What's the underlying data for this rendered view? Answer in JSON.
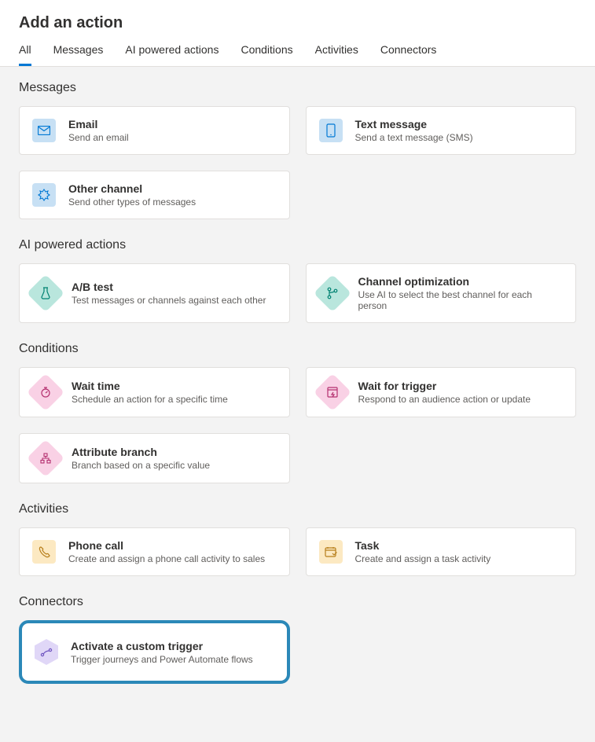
{
  "header": {
    "title": "Add an action"
  },
  "tabs": [
    {
      "label": "All",
      "active": true
    },
    {
      "label": "Messages"
    },
    {
      "label": "AI powered actions"
    },
    {
      "label": "Conditions"
    },
    {
      "label": "Activities"
    },
    {
      "label": "Connectors"
    }
  ],
  "sections": {
    "messages": {
      "title": "Messages",
      "cards": [
        {
          "title": "Email",
          "desc": "Send an email"
        },
        {
          "title": "Text message",
          "desc": "Send a text message (SMS)"
        },
        {
          "title": "Other channel",
          "desc": "Send other types of messages"
        }
      ]
    },
    "ai": {
      "title": "AI powered actions",
      "cards": [
        {
          "title": "A/B test",
          "desc": "Test messages or channels against each other"
        },
        {
          "title": "Channel optimization",
          "desc": "Use AI to select the best channel for each person"
        }
      ]
    },
    "conditions": {
      "title": "Conditions",
      "cards": [
        {
          "title": "Wait time",
          "desc": "Schedule an action for a specific time"
        },
        {
          "title": "Wait for trigger",
          "desc": "Respond to an audience action or update"
        },
        {
          "title": "Attribute branch",
          "desc": "Branch based on a specific value"
        }
      ]
    },
    "activities": {
      "title": "Activities",
      "cards": [
        {
          "title": "Phone call",
          "desc": "Create and assign a phone call activity to sales"
        },
        {
          "title": "Task",
          "desc": "Create and assign a task activity"
        }
      ]
    },
    "connectors": {
      "title": "Connectors",
      "cards": [
        {
          "title": "Activate a custom trigger",
          "desc": "Trigger journeys and Power Automate flows"
        }
      ]
    }
  }
}
